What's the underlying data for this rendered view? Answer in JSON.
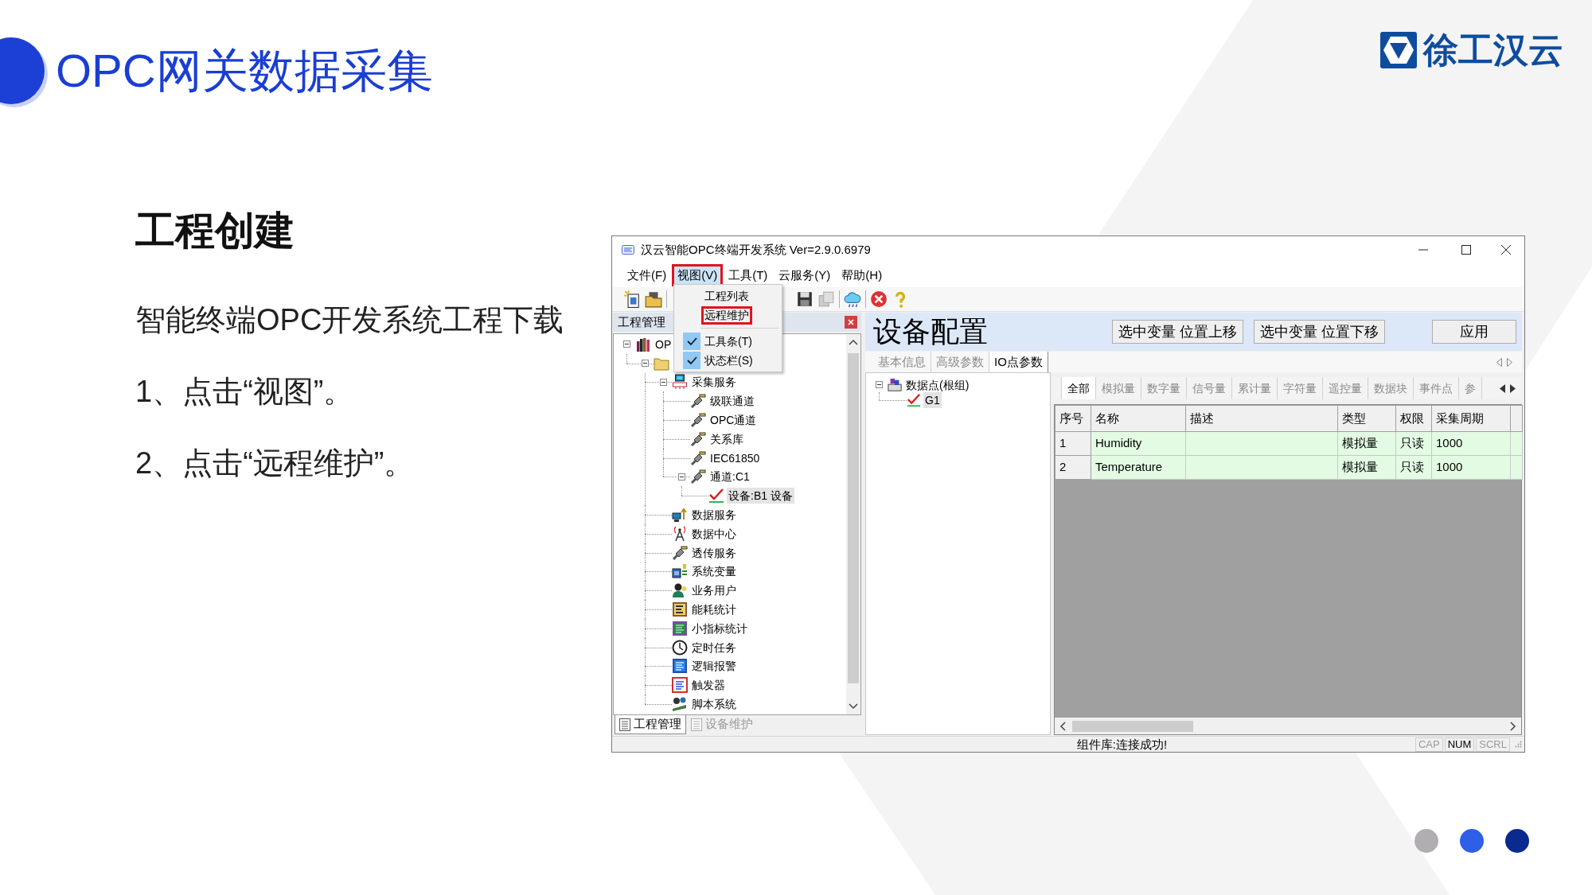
{
  "slide": {
    "title": "OPC网关数据采集",
    "logo": {
      "text": "徐工汉云"
    },
    "heading": "工程创建",
    "paragraphs": [
      "智能终端OPC开发系统工程下载",
      "1、点击“视图”。",
      "2、点击“远程维护”。"
    ],
    "page_dots": [
      {
        "color": "#b0aeb0"
      },
      {
        "color": "#2f5ee8"
      },
      {
        "color": "#0a2a8f"
      }
    ]
  },
  "window": {
    "title": "汉云智能OPC终端开发系统 Ver=2.9.0.6979",
    "menu": [
      {
        "label": "文件(F)",
        "selected": false,
        "outlined": false
      },
      {
        "label": "视图(V)",
        "selected": true,
        "outlined": true
      },
      {
        "label": "工具(T)",
        "selected": false,
        "outlined": false
      },
      {
        "label": "云服务(Y)",
        "selected": false,
        "outlined": false
      },
      {
        "label": "帮助(H)",
        "selected": false,
        "outlined": false
      }
    ],
    "dropdown": [
      {
        "kind": "item",
        "label": "工程列表",
        "checked": false,
        "outlined": false
      },
      {
        "kind": "item",
        "label": "远程维护",
        "checked": false,
        "outlined": true
      },
      {
        "kind": "separator"
      },
      {
        "kind": "item",
        "label": "工具条(T)",
        "checked": true,
        "outlined": false
      },
      {
        "kind": "item",
        "label": "状态栏(S)",
        "checked": true,
        "outlined": false
      }
    ],
    "toolbar": [
      {
        "kind": "new",
        "disabled": false
      },
      {
        "kind": "open",
        "disabled": false
      },
      {
        "kind": "separator"
      },
      {
        "kind": "save",
        "disabled": false
      },
      {
        "kind": "copy",
        "disabled": true
      },
      {
        "kind": "separator"
      },
      {
        "kind": "cloud",
        "disabled": false
      },
      {
        "kind": "separator"
      },
      {
        "kind": "delete",
        "disabled": false
      },
      {
        "kind": "help",
        "disabled": false
      }
    ],
    "project_panel": {
      "title": "工程管理",
      "tree": [
        {
          "label": "OP",
          "kind": "project",
          "expanded": true,
          "selected": false,
          "children": [
            {
              "kind": "folder",
              "expanded": true,
              "selected": false,
              "children": [
                {
                  "label": "采集服务",
                  "kind": "service",
                  "expanded": true,
                  "selected": false,
                  "children": [
                    {
                      "label": "级联通道",
                      "kind": "channel",
                      "selected": false
                    },
                    {
                      "label": "OPC通道",
                      "kind": "channel",
                      "selected": false
                    },
                    {
                      "label": "关系库",
                      "kind": "channel",
                      "selected": false
                    },
                    {
                      "label": "IEC61850",
                      "kind": "channel",
                      "selected": false
                    },
                    {
                      "label": "通道:C1",
                      "kind": "channel",
                      "expanded": true,
                      "selected": false,
                      "children": [
                        {
                          "label": "设备:B1 设备",
                          "kind": "device",
                          "selected": true
                        }
                      ]
                    }
                  ]
                },
                {
                  "label": "数据服务",
                  "kind": "upload",
                  "selected": false
                },
                {
                  "label": "数据中心",
                  "kind": "antenna",
                  "selected": false
                },
                {
                  "label": "透传服务",
                  "kind": "channel",
                  "selected": false
                },
                {
                  "label": "系统变量",
                  "kind": "variables",
                  "selected": false
                },
                {
                  "label": "业务用户",
                  "kind": "users",
                  "selected": false
                },
                {
                  "label": "能耗统计",
                  "kind": "energy",
                  "selected": false
                },
                {
                  "label": "小指标统计",
                  "kind": "stats",
                  "selected": false
                },
                {
                  "label": "定时任务",
                  "kind": "timer",
                  "selected": false
                },
                {
                  "label": "逻辑报警",
                  "kind": "alarm",
                  "selected": false
                },
                {
                  "label": "触发器",
                  "kind": "trigger",
                  "selected": false
                },
                {
                  "label": "脚本系统",
                  "kind": "script",
                  "selected": false
                }
              ]
            }
          ]
        }
      ],
      "tabs": [
        {
          "label": "工程管理",
          "selected": true
        },
        {
          "label": "设备维护",
          "selected": false
        }
      ]
    },
    "device_panel": {
      "title": "设备配置",
      "buttons": [
        "选中变量 位置上移",
        "选中变量 位置下移",
        "应用"
      ],
      "tabs": [
        {
          "label": "基本信息",
          "selected": false
        },
        {
          "label": "高级参数",
          "selected": false
        },
        {
          "label": "IO点参数",
          "selected": true
        }
      ],
      "point_tree": [
        {
          "label": "数据点(根组)",
          "kind": "group",
          "expanded": true,
          "selected": false,
          "children": [
            {
              "label": "G1",
              "kind": "point",
              "selected": true
            }
          ]
        }
      ],
      "point_tabs": [
        {
          "label": "全部",
          "selected": true
        },
        {
          "label": "模拟量",
          "selected": false
        },
        {
          "label": "数字量",
          "selected": false
        },
        {
          "label": "信号量",
          "selected": false
        },
        {
          "label": "累计量",
          "selected": false
        },
        {
          "label": "字符量",
          "selected": false
        },
        {
          "label": "遥控量",
          "selected": false
        },
        {
          "label": "数据块",
          "selected": false
        },
        {
          "label": "事件点",
          "selected": false
        },
        {
          "label": "参",
          "selected": false
        }
      ],
      "table": {
        "columns": [
          "序号",
          "名称",
          "描述",
          "类型",
          "权限",
          "采集周期"
        ],
        "rows": [
          {
            "number": "1",
            "name": "Humidity",
            "type": "模拟量",
            "access": "只读",
            "period": "1000"
          },
          {
            "number": "2",
            "name": "Temperature",
            "type": "模拟量",
            "access": "只读",
            "period": "1000"
          }
        ]
      }
    },
    "status_bar": {
      "message": "组件库:连接成功!",
      "indicators": [
        {
          "label": "CAP",
          "on": false
        },
        {
          "label": "NUM",
          "on": true
        },
        {
          "label": "SCRL",
          "on": false
        }
      ]
    }
  }
}
